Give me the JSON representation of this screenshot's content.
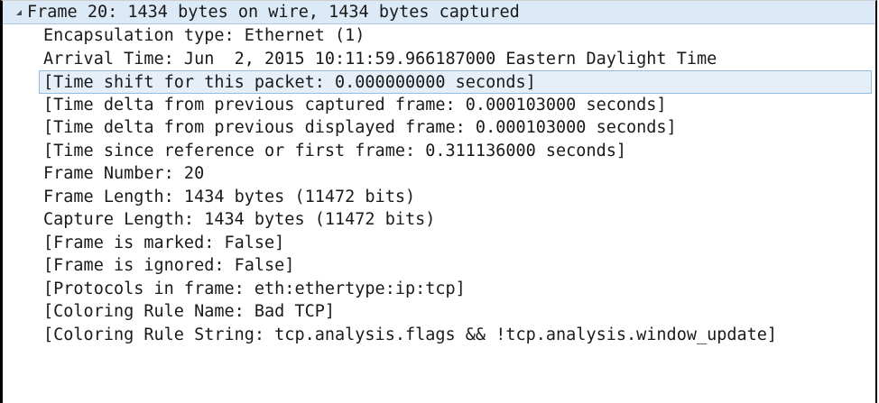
{
  "frame": {
    "header": "Frame 20: 1434 bytes on wire, 1434 bytes captured",
    "expanded": true,
    "fields": [
      "Encapsulation type: Ethernet (1)",
      "Arrival Time: Jun  2, 2015 10:11:59.966187000 Eastern Daylight Time",
      "[Time shift for this packet: 0.000000000 seconds]",
      "[Time delta from previous captured frame: 0.000103000 seconds]",
      "[Time delta from previous displayed frame: 0.000103000 seconds]",
      "[Time since reference or first frame: 0.311136000 seconds]",
      "Frame Number: 20",
      "Frame Length: 1434 bytes (11472 bits)",
      "Capture Length: 1434 bytes (11472 bits)",
      "[Frame is marked: False]",
      "[Frame is ignored: False]",
      "[Protocols in frame: eth:ethertype:ip:tcp]",
      "[Coloring Rule Name: Bad TCP]",
      "[Coloring Rule String: tcp.analysis.flags && !tcp.analysis.window_update]"
    ]
  },
  "colors": {
    "header_bg": "#dceaf7",
    "selection_bg": "#e6eff8",
    "selection_border": "#93bde6"
  },
  "icons": {
    "expander": "collapse-triangle-icon"
  }
}
